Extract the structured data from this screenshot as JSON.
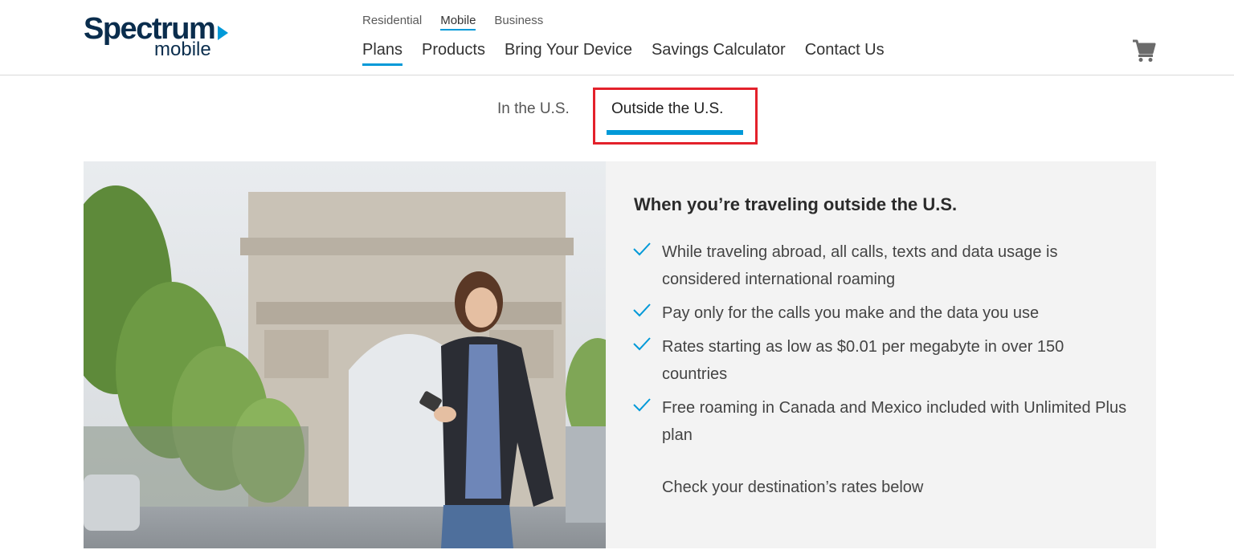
{
  "logo": {
    "brand": "Spectrum",
    "sub": "mobile"
  },
  "top_nav": [
    "Residential",
    "Mobile",
    "Business"
  ],
  "main_nav": [
    "Plans",
    "Products",
    "Bring Your Device",
    "Savings Calculator",
    "Contact Us"
  ],
  "tabs": {
    "in_us": "In the U.S.",
    "outside_us": "Outside the U.S."
  },
  "content": {
    "heading": "When you’re traveling outside the U.S.",
    "items": [
      "While traveling abroad, all calls, texts and data usage is considered international roaming",
      "Pay only for the calls you make and the data you use",
      "Rates starting as low as $0.01 per megabyte in over 150 countries",
      "Free roaming in Canada and Mexico included with Unlimited Plus plan"
    ],
    "cta": "Check your destination’s rates below"
  },
  "colors": {
    "accent": "#0099d8",
    "highlight": "#e3212b",
    "brand": "#0a2d4d",
    "panel": "#f3f3f3"
  },
  "icons": {
    "cart": "cart-icon",
    "check": "check-icon"
  }
}
